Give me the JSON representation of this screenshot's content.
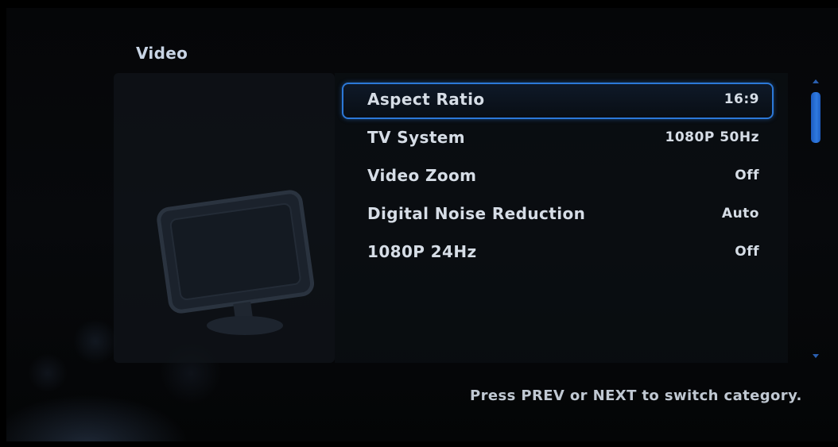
{
  "page": {
    "title": "Video",
    "hint": "Press PREV or NEXT to switch category.",
    "category_icon": "monitor-icon"
  },
  "settings": {
    "selected_index": 0,
    "items": [
      {
        "label": "Aspect Ratio",
        "value": "16:9"
      },
      {
        "label": "TV System",
        "value": "1080P 50Hz"
      },
      {
        "label": "Video Zoom",
        "value": "Off"
      },
      {
        "label": "Digital Noise Reduction",
        "value": "Auto"
      },
      {
        "label": "1080P 24Hz",
        "value": "Off"
      }
    ]
  },
  "colors": {
    "accent": "#2c78d8",
    "text": "#d6dde6",
    "background": "#06080b"
  }
}
